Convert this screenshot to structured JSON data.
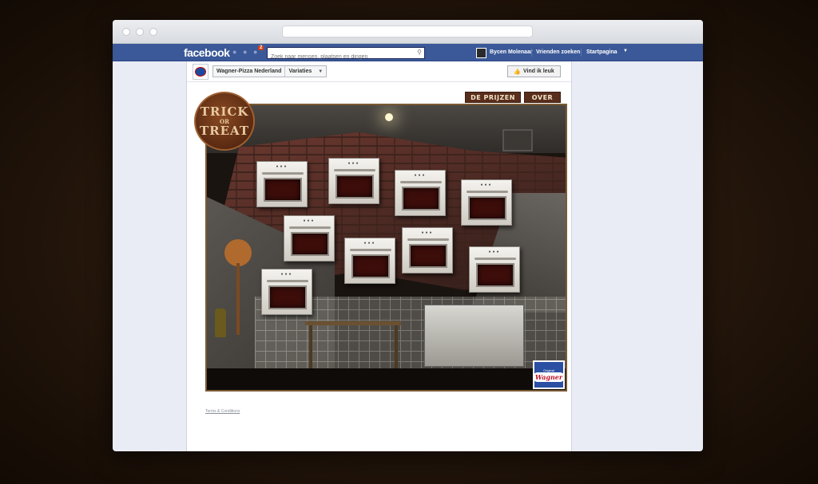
{
  "browser": {
    "window_dots": [
      "close",
      "minimize",
      "zoom"
    ]
  },
  "facebook_bar": {
    "logo": "facebook",
    "notification_count": "2",
    "search_placeholder": "Zoek naar mensen, plaatsen en dingen",
    "user_name": "Bycen Molenaar",
    "links": [
      "Vrienden zoeken",
      "Startpagina"
    ],
    "colors": {
      "bar": "#3b5998"
    }
  },
  "page_header": {
    "page_name": "Wagner-Pizza Nederland",
    "variations_label": "Variaties",
    "like_label": "Vind ik leuk"
  },
  "app": {
    "logo_lines": [
      "TRICK",
      "OR",
      "TREAT"
    ],
    "tabs": [
      "DE PRIJZEN",
      "OVER"
    ],
    "oven_count": 9,
    "brand_small": "Original",
    "brand_name": "Wagner",
    "terms": "Terms & Conditions"
  }
}
